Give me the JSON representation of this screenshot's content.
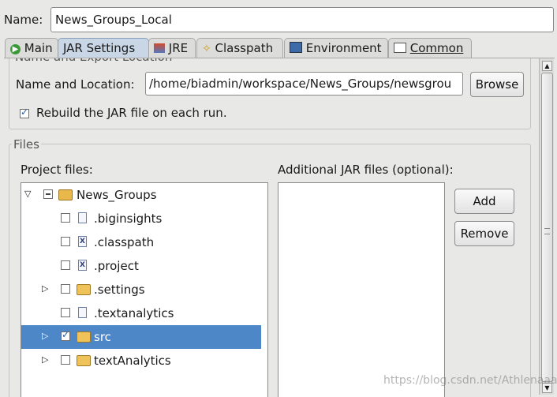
{
  "name_label": "Name:",
  "name_value": "News_Groups_Local",
  "tabs": [
    {
      "label": "Main",
      "icon": "run-icon"
    },
    {
      "label": "JAR Settings",
      "icon": "jar-icon"
    },
    {
      "label": "JRE",
      "icon": "jre-icon"
    },
    {
      "label": "Classpath",
      "icon": "classpath-icon"
    },
    {
      "label": "Environment",
      "icon": "environment-icon"
    },
    {
      "label": "Common",
      "icon": "common-icon"
    }
  ],
  "export": {
    "group_title": "Name and Export Location",
    "location_label": "Name and Location:",
    "location_value": "/home/biadmin/workspace/News_Groups/newsgrou",
    "browse_label": "Browse",
    "rebuild_label": "Rebuild the JAR file on each run.",
    "rebuild_checked": true
  },
  "files": {
    "group_title": "Files",
    "project_label": "Project files:",
    "additional_label": "Additional JAR files (optional):",
    "add_label": "Add",
    "remove_label": "Remove",
    "tree": [
      {
        "label": "News_Groups",
        "type": "project",
        "expander": "expanded",
        "checked": false
      },
      {
        "label": ".biginsights",
        "type": "file",
        "expander": "none",
        "checked": false
      },
      {
        "label": ".classpath",
        "type": "xml",
        "expander": "none",
        "checked": false
      },
      {
        "label": ".project",
        "type": "xml",
        "expander": "none",
        "checked": false
      },
      {
        "label": ".settings",
        "type": "folder",
        "expander": "collapsed",
        "checked": false
      },
      {
        "label": ".textanalytics",
        "type": "file",
        "expander": "none",
        "checked": false
      },
      {
        "label": "src",
        "type": "folder",
        "expander": "collapsed",
        "checked": true,
        "selected": true
      },
      {
        "label": "textAnalytics",
        "type": "folder",
        "expander": "collapsed",
        "checked": false
      }
    ]
  },
  "watermark": "https://blog.csdn.net/Athlenaaa",
  "colors": {
    "selection": "#4d87c7",
    "active_tab": "#c9d6e6",
    "background": "#e8e8e7"
  }
}
